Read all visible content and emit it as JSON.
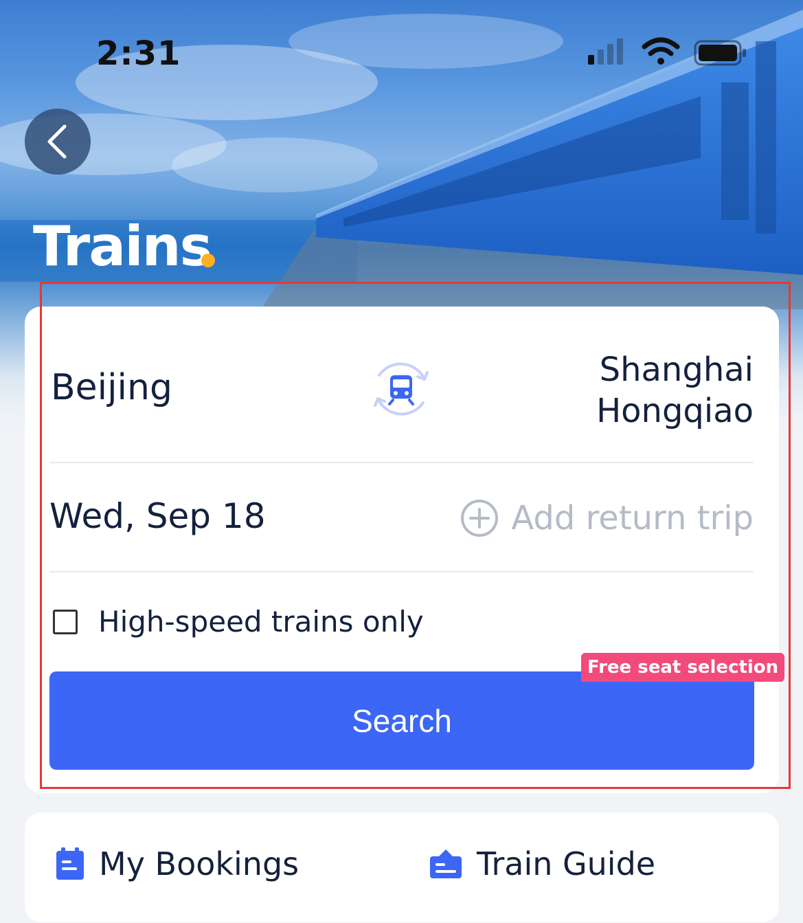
{
  "status_bar": {
    "time": "2:31",
    "icons": [
      "signal-icon",
      "wifi-icon",
      "battery-icon"
    ]
  },
  "header": {
    "title": "Trains"
  },
  "search_form": {
    "from_city": "Beijing",
    "to_city_line1": "Shanghai",
    "to_city_line2": "Hongqiao",
    "swap_icon": "train-swap-icon",
    "departure_date": "Wed, Sep 18",
    "add_return_label": "Add return trip",
    "high_speed_label": "High-speed trains only",
    "high_speed_checked": false,
    "search_label": "Search",
    "promo_badge": "Free seat selection"
  },
  "quick_links": [
    {
      "label": "My Bookings",
      "icon": "bookings-icon"
    },
    {
      "label": "Train Guide",
      "icon": "guide-icon"
    }
  ],
  "colors": {
    "primary": "#3c66f5",
    "promo": "#f24a7b",
    "title_dot": "#ffb020",
    "text_dark": "#14213d",
    "muted": "#b5bbc6"
  }
}
